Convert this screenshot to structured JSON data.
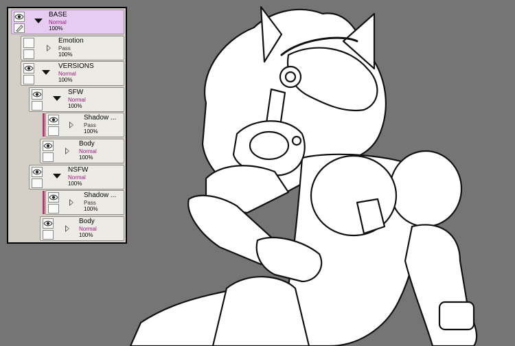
{
  "layers": [
    {
      "name": "BASE",
      "mode": "Normal",
      "opacity": "100%",
      "type": "folder",
      "expanded": true,
      "selected": true
    },
    {
      "name": "Emotion",
      "mode": "Pass",
      "opacity": "100%",
      "type": "folder",
      "expanded": false
    },
    {
      "name": "VERSIONS",
      "mode": "Normal",
      "opacity": "100%",
      "type": "folder",
      "expanded": true
    },
    {
      "name": "SFW",
      "mode": "Normal",
      "opacity": "100%",
      "type": "folder",
      "expanded": true
    },
    {
      "name": "Shadow ...",
      "mode": "Pass",
      "opacity": "100%",
      "type": "folder",
      "expanded": false,
      "clipped": true
    },
    {
      "name": "Body",
      "mode": "Normal",
      "opacity": "100%",
      "type": "folder",
      "expanded": false
    },
    {
      "name": "NSFW",
      "mode": "Normal",
      "opacity": "100%",
      "type": "folder",
      "expanded": true
    },
    {
      "name": "Shadow ...",
      "mode": "Pass",
      "opacity": "100%",
      "type": "folder",
      "expanded": false,
      "clipped": true
    },
    {
      "name": "Body",
      "mode": "Normal",
      "opacity": "100%",
      "type": "folder",
      "expanded": false
    }
  ],
  "colors": {
    "canvas_background": "#757575",
    "selected_layer": "#e6ccf0",
    "normal_mode_text": "#a0157b",
    "clip_indicator": "#c0306a"
  }
}
